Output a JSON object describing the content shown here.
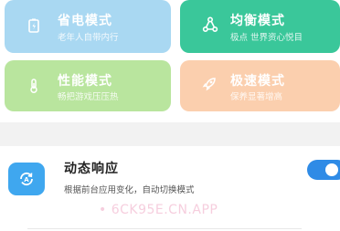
{
  "modes": [
    {
      "title": "省电模式",
      "subtitle": "老年人自带内行",
      "icon": "battery-icon",
      "color": "#a9d8f2"
    },
    {
      "title": "均衡模式",
      "subtitle": "极点 世界资心悦目",
      "icon": "triangle-nodes-icon",
      "color": "#3ac79a"
    },
    {
      "title": "性能模式",
      "subtitle": "畅把游戏压压热",
      "icon": "thermometer-icon",
      "color": "#b9e59e"
    },
    {
      "title": "极速模式",
      "subtitle": "保养显著增高",
      "icon": "rocket-icon",
      "color": "#fbcfae"
    }
  ],
  "dynamic_response": {
    "title": "动态响应",
    "description": "根据前台应用变化，自动切换模式",
    "enabled": true,
    "icon": "auto-switch-icon"
  },
  "watermark": "• 6CK95E.CN.APP",
  "accent_color": "#2f8be6"
}
